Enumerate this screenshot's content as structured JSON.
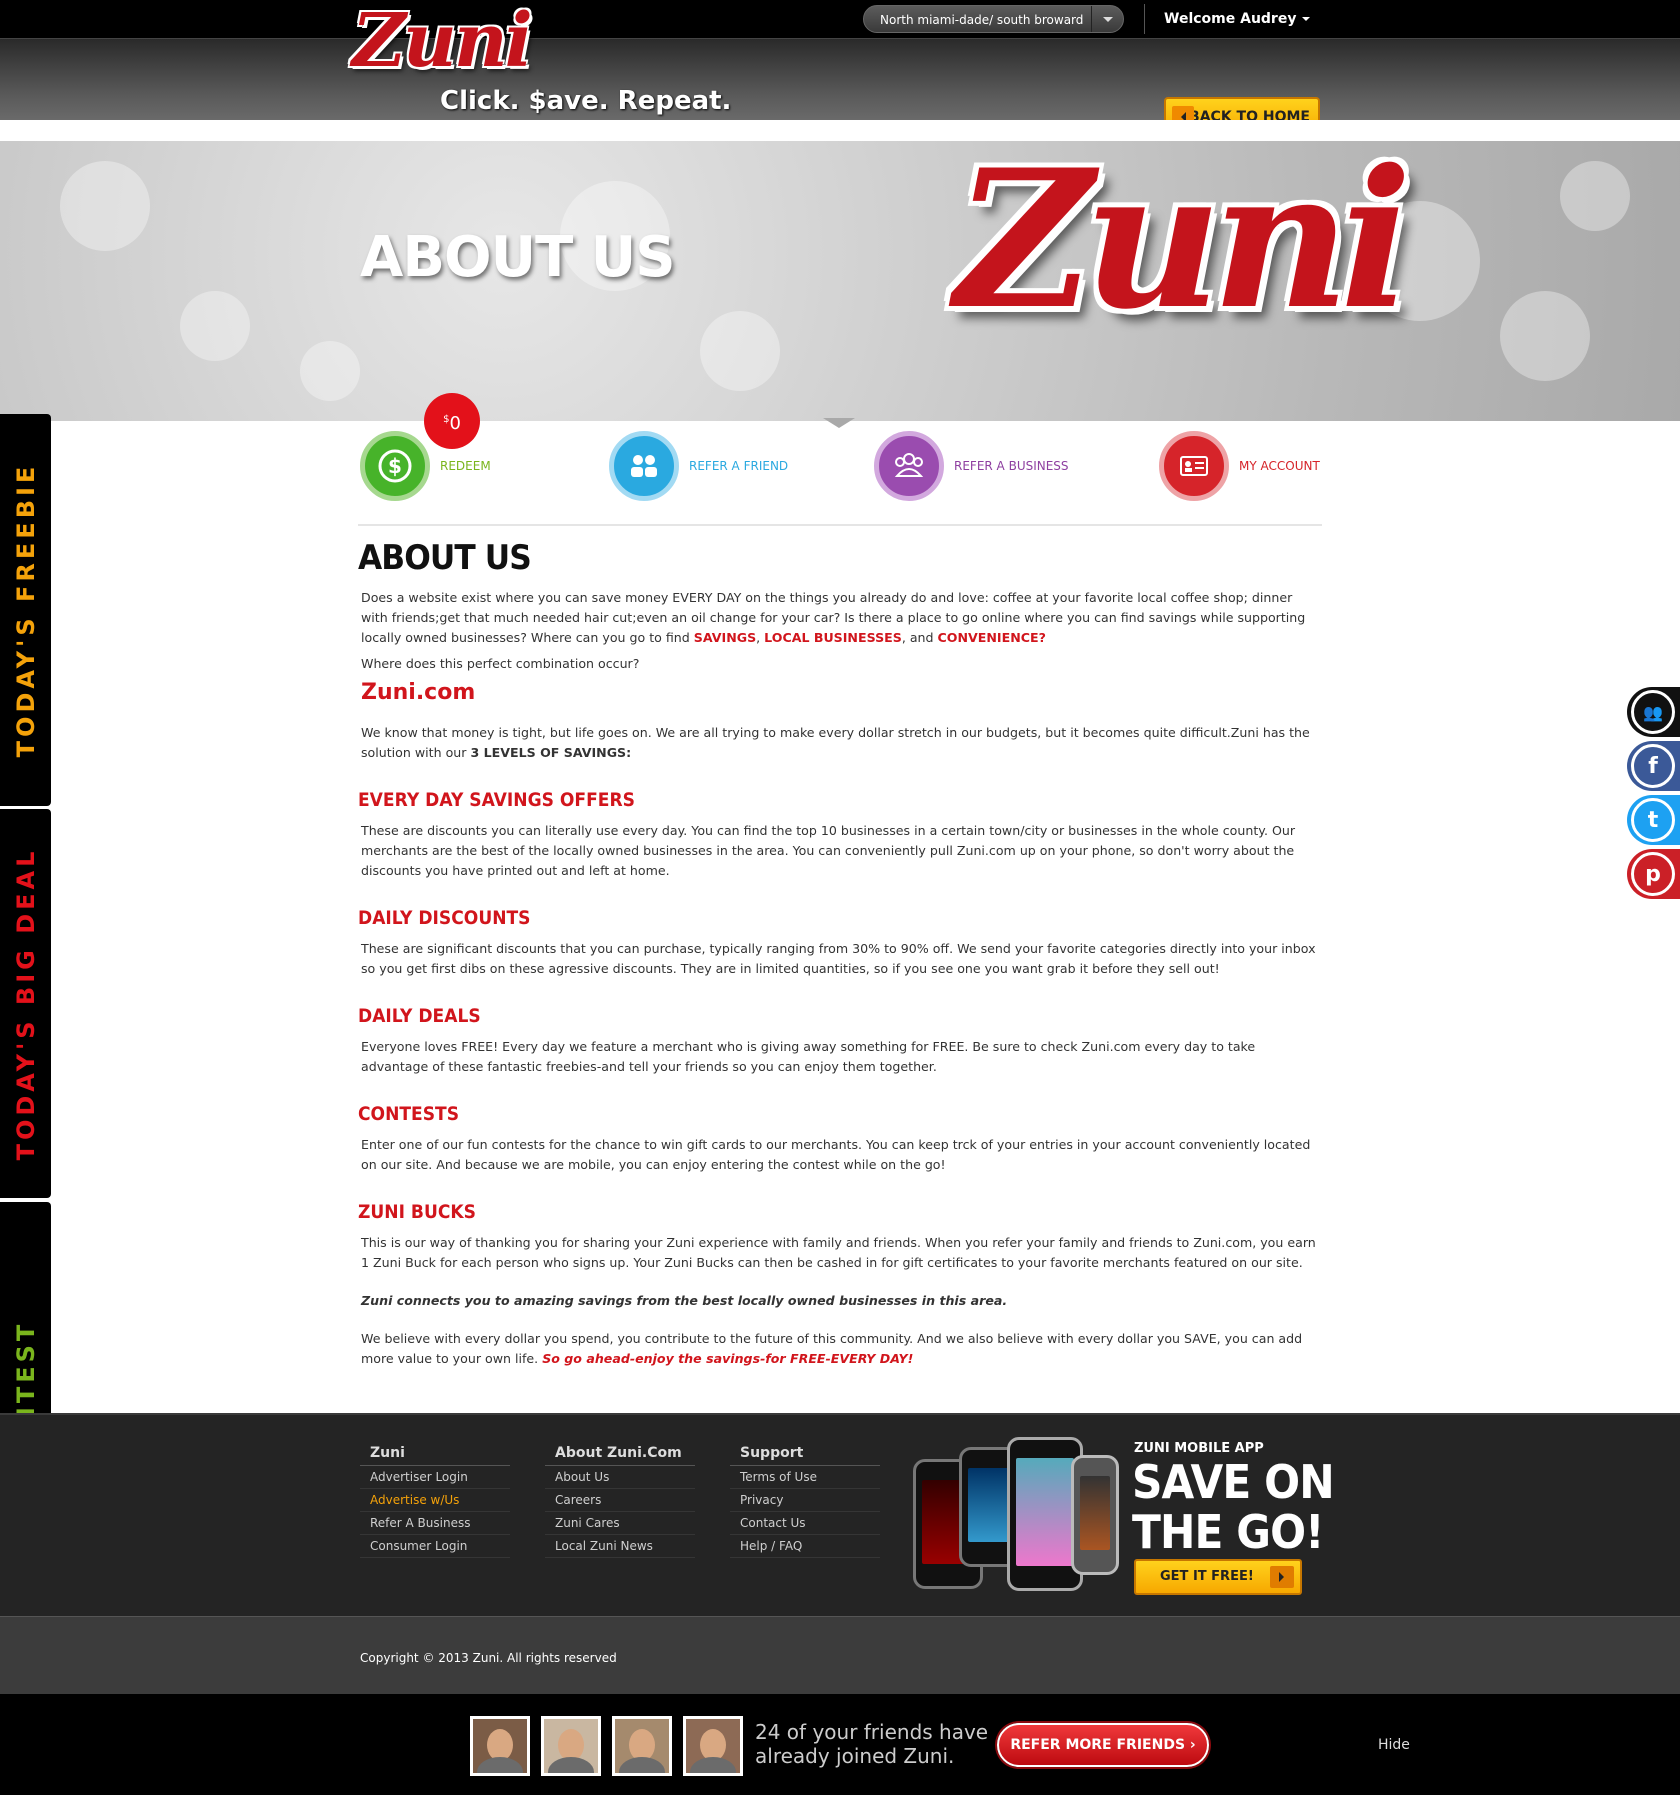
{
  "header": {
    "logo_word": "Zuni",
    "tagline": "Click. $ave. Repeat.",
    "region_selected": "North miami-dade/ south broward",
    "welcome": "Welcome Audrey",
    "back_home": "BACK TO HOME"
  },
  "hero": {
    "title": "ABOUT US",
    "logo_word": "Zuni"
  },
  "nav": {
    "badge_currency": "$",
    "badge_value": "0",
    "items": [
      {
        "label": "REDEEM",
        "color": "#7ab51d"
      },
      {
        "label": "REFER A FRIEND",
        "color": "#2aa9e0"
      },
      {
        "label": "REFER A BUSINESS",
        "color": "#8e3fa0"
      },
      {
        "label": "MY ACCOUNT",
        "color": "#d6242a"
      }
    ]
  },
  "content": {
    "title": "ABOUT US",
    "intro": "Does a website exist where you can save money EVERY DAY on the things you already do and love: coffee at your favorite local coffee shop; dinner with friends;get that much needed hair cut;even an oil change for your car? Is there a place to go online where you can find savings while supporting locally owned businesses? Where can you go to find",
    "intro_savings": "SAVINGS",
    "intro_comma": ",",
    "intro_local": "LOCAL BUSINESSES",
    "intro_and": ", and",
    "intro_convenience": "CONVENIENCE?",
    "where": "Where does this perfect combination occur?",
    "zunicom": "Zuni.com",
    "money": "We know that money is tight, but life goes on. We are all trying to make every dollar stretch in our budgets, but it becomes quite difficult.Zuni has the solution with our",
    "levels": "3 LEVELS OF SAVINGS:",
    "sections": [
      {
        "heading": "EVERY DAY SAVINGS OFFERS",
        "text": "These are discounts you can literally use every day. You can find the top 10 businesses in a certain town/city or businesses in the whole county. Our merchants are the best of the locally owned businesses in the area. You can conveniently pull Zuni.com up on your phone, so don't worry about the discounts you have printed out and left at home."
      },
      {
        "heading": "DAILY DISCOUNTS",
        "text": "These are significant discounts that you can purchase, typically ranging from 30% to 90% off. We send your favorite categories directly into your inbox so you get first dibs on these agressive discounts. They are in limited quantities, so if you see one you want grab it before they sell out!"
      },
      {
        "heading": "DAILY DEALS",
        "text": "Everyone loves FREE! Every day we feature a merchant who is giving away something for FREE. Be sure to check Zuni.com every day to take advantage of these fantastic freebies-and tell your friends so you can enjoy them together."
      },
      {
        "heading": "CONTESTS",
        "text": "Enter one of our fun contests for the chance to win gift cards to our merchants. You can keep trck of your entries in your account conveniently located on our site. And because we are mobile, you can enjoy entering the contest while on the go!"
      },
      {
        "heading": "ZUNI BUCKS",
        "text": "This is our way of thanking you for sharing your Zuni experience with family and friends. When you refer your family and friends to Zuni.com, you earn 1 Zuni Buck for each person who signs up. Your Zuni Bucks can then be cashed in for gift certificates to your favorite merchants featured on our site."
      }
    ],
    "connects": "Zuni connects you to amazing savings from the best locally owned businesses in this area.",
    "believe": "We believe with every dollar you spend,  you contribute to the future of this community. And we also believe with every dollar you SAVE, you can add more value to your own life.",
    "believe_red": "So go ahead-enjoy the savings-for FREE-EVERY DAY!"
  },
  "side_tabs": [
    {
      "label": "TODAY'S FREEBIE",
      "color": "#f4a20a"
    },
    {
      "label": "TODAY'S BIG DEAL",
      "color": "#e3111a"
    },
    {
      "label": "CONTEST",
      "color": "#7ab51d"
    }
  ],
  "social": [
    {
      "name": "friends",
      "glyph": "👥",
      "color": "#111111"
    },
    {
      "name": "facebook",
      "glyph": "f",
      "color": "#3b5998"
    },
    {
      "name": "twitter",
      "glyph": "t",
      "color": "#1da1f2"
    },
    {
      "name": "pinterest",
      "glyph": "p",
      "color": "#cb2027"
    }
  ],
  "footer": {
    "cols": [
      {
        "title": "Zuni",
        "links": [
          "Advertiser Login",
          "Advertise w/Us",
          "Refer A Business",
          "Consumer Login"
        ]
      },
      {
        "title": "About Zuni.Com",
        "links": [
          "About Us",
          "Careers",
          "Zuni Cares",
          "Local Zuni News"
        ]
      },
      {
        "title": "Support",
        "links": [
          "Terms of Use",
          "Privacy",
          "Contact Us",
          "Help / FAQ"
        ]
      }
    ],
    "app_title": "ZUNI MOBILE APP",
    "app_big_1": "SAVE ON",
    "app_big_2": "THE GO!",
    "get_free": "GET IT FREE!",
    "copyright": "Copyright © 2013 Zuni. All rights reserved"
  },
  "friendbar": {
    "text_1": "24 of your friends have",
    "text_2": "already joined Zuni.",
    "refer_more": "REFER MORE FRIENDS",
    "hide": "Hide"
  }
}
